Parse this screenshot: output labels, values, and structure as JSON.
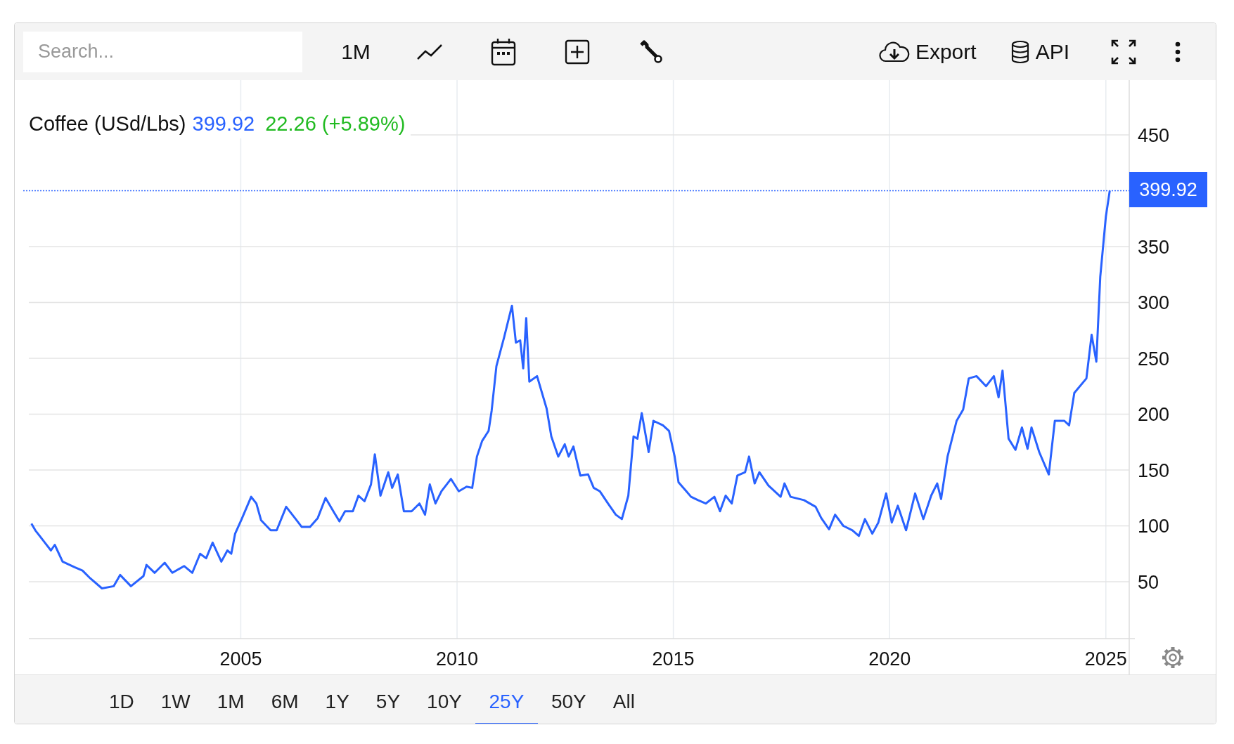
{
  "toolbar": {
    "search": {
      "placeholder": "Search..."
    },
    "interval": "1M",
    "tools": [
      {
        "kind": "chart-type"
      },
      {
        "kind": "calendar"
      },
      {
        "kind": "add"
      },
      {
        "kind": "tools"
      }
    ],
    "actions": [
      {
        "kind": "export",
        "label": "Export"
      },
      {
        "kind": "api",
        "label": "API"
      },
      {
        "kind": "fullscreen"
      },
      {
        "kind": "more"
      }
    ]
  },
  "chart": {
    "legend": {
      "title": "Coffee (USd/Lbs)",
      "price": "399.92",
      "change": "22.26 (+5.89%)"
    },
    "price_tag": "399.92",
    "chart_data": {
      "type": "line",
      "xlim": [
        2000.1,
        2025.54
      ],
      "ylim": [
        0,
        499
      ],
      "grid": true,
      "xticks": [
        2005,
        2010,
        2015,
        2020,
        2025
      ],
      "yticks": [
        50,
        100,
        150,
        200,
        250,
        300,
        350,
        450
      ],
      "ref_lines": [
        {
          "axis": "y",
          "value": 400,
          "color": "#2962ff"
        }
      ],
      "x": [
        2000.16,
        2000.25,
        2000.47,
        2000.61,
        2000.7,
        2000.88,
        2001.16,
        2001.34,
        2001.52,
        2001.79,
        2002.06,
        2002.21,
        2002.46,
        2002.75,
        2002.82,
        2003.01,
        2003.24,
        2003.42,
        2003.69,
        2003.88,
        2004.06,
        2004.2,
        2004.35,
        2004.55,
        2004.69,
        2004.78,
        2004.87,
        2005.02,
        2005.24,
        2005.36,
        2005.47,
        2005.69,
        2005.83,
        2006.05,
        2006.27,
        2006.41,
        2006.6,
        2006.78,
        2006.96,
        2007.14,
        2007.28,
        2007.41,
        2007.59,
        2007.72,
        2007.86,
        2008.01,
        2008.1,
        2008.23,
        2008.41,
        2008.5,
        2008.63,
        2008.77,
        2008.95,
        2009.13,
        2009.26,
        2009.37,
        2009.5,
        2009.64,
        2009.86,
        2010.04,
        2010.22,
        2010.35,
        2010.46,
        2010.58,
        2010.73,
        2010.8,
        2010.91,
        2011.09,
        2011.27,
        2011.36,
        2011.46,
        2011.53,
        2011.6,
        2011.67,
        2011.85,
        2012.07,
        2012.18,
        2012.34,
        2012.49,
        2012.58,
        2012.69,
        2012.85,
        2013.03,
        2013.16,
        2013.3,
        2013.49,
        2013.67,
        2013.81,
        2013.96,
        2014.08,
        2014.17,
        2014.27,
        2014.43,
        2014.54,
        2014.76,
        2014.9,
        2015.03,
        2015.12,
        2015.3,
        2015.41,
        2015.57,
        2015.75,
        2015.95,
        2016.08,
        2016.21,
        2016.35,
        2016.48,
        2016.66,
        2016.75,
        2016.88,
        2016.99,
        2017.2,
        2017.48,
        2017.57,
        2017.71,
        2018.02,
        2018.29,
        2018.42,
        2018.6,
        2018.74,
        2018.93,
        2019.14,
        2019.29,
        2019.43,
        2019.6,
        2019.74,
        2019.92,
        2020.05,
        2020.19,
        2020.38,
        2020.59,
        2020.78,
        2020.96,
        2021.1,
        2021.19,
        2021.34,
        2021.55,
        2021.7,
        2021.83,
        2022.01,
        2022.23,
        2022.41,
        2022.52,
        2022.61,
        2022.75,
        2022.91,
        2023.06,
        2023.19,
        2023.28,
        2023.46,
        2023.68,
        2023.82,
        2024.04,
        2024.15,
        2024.27,
        2024.55,
        2024.67,
        2024.78,
        2024.87,
        2025.0,
        2025.09
      ],
      "series": [
        {
          "color": "#2962ff",
          "values": [
            102,
            96,
            85,
            78,
            83,
            68,
            63,
            60,
            53,
            44,
            46,
            56,
            46,
            55,
            65,
            58,
            67,
            58,
            64,
            58,
            75,
            71,
            85,
            68,
            78,
            75,
            93,
            106,
            126,
            120,
            105,
            96,
            96,
            117,
            106,
            99,
            99,
            107,
            125,
            113,
            104,
            113,
            113,
            127,
            122,
            137,
            164,
            127,
            148,
            134,
            146,
            113,
            113,
            120,
            110,
            137,
            120,
            131,
            142,
            131,
            135,
            134,
            162,
            176,
            185,
            203,
            243,
            269,
            297,
            264,
            266,
            241,
            286,
            229,
            234,
            205,
            180,
            162,
            173,
            162,
            171,
            145,
            146,
            134,
            131,
            120,
            110,
            106,
            127,
            180,
            178,
            201,
            166,
            194,
            190,
            185,
            162,
            139,
            131,
            126,
            123,
            120,
            126,
            113,
            127,
            120,
            145,
            148,
            162,
            138,
            148,
            136,
            126,
            138,
            126,
            123,
            117,
            107,
            97,
            110,
            100,
            96,
            91,
            106,
            93,
            103,
            129,
            103,
            118,
            96,
            129,
            106,
            127,
            138,
            124,
            162,
            194,
            204,
            232,
            234,
            225,
            234,
            215,
            239,
            178,
            168,
            188,
            169,
            188,
            166,
            146,
            194,
            194,
            190,
            219,
            232,
            271,
            247,
            323,
            377,
            400
          ]
        }
      ]
    }
  },
  "ranges": [
    {
      "label": "1D",
      "selected": false
    },
    {
      "label": "1W",
      "selected": false
    },
    {
      "label": "1M",
      "selected": false
    },
    {
      "label": "6M",
      "selected": false
    },
    {
      "label": "1Y",
      "selected": false
    },
    {
      "label": "5Y",
      "selected": false
    },
    {
      "label": "10Y",
      "selected": false
    },
    {
      "label": "25Y",
      "selected": true
    },
    {
      "label": "50Y",
      "selected": false
    },
    {
      "label": "All",
      "selected": false
    }
  ]
}
